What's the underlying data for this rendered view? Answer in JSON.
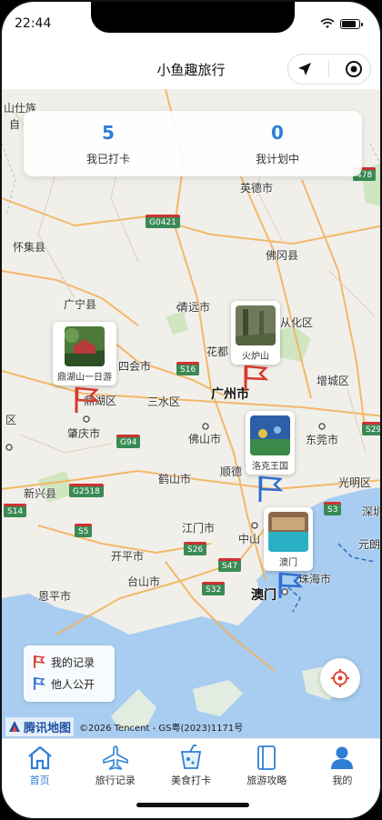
{
  "status": {
    "time": "22:44"
  },
  "nav": {
    "title": "小鱼趣旅行"
  },
  "stats": [
    {
      "value": "5",
      "label": "我已打卡"
    },
    {
      "value": "0",
      "label": "我计划中"
    }
  ],
  "map": {
    "cities": {
      "yingde": "英德市",
      "huaiji": "怀集县",
      "fogang": "佛冈县",
      "guangning": "广宁县",
      "qingyuan": "清远市",
      "huadu": "花都",
      "conghua": "从化区",
      "sihui": "四会市",
      "zengcheng": "增城区",
      "dinghu": "鼎湖区",
      "sanshui": "三水区",
      "guangzhou": "广州市",
      "zhaoqing": "肇庆市",
      "foshan": "佛山市",
      "dongguan": "东莞市",
      "xinxing": "新兴县",
      "heshan": "鹤山市",
      "shunde": "顺德",
      "guangming": "光明区",
      "jiangmen": "江门市",
      "zhongshan": "中山",
      "kaiping": "开平市",
      "taishan": "台山市",
      "enping": "恩平市",
      "zhuhai": "珠海市",
      "macau": "澳门",
      "shenzhen": "深圳",
      "yuanlang": "元朗",
      "shanglin": "山仕族",
      "zi": "自",
      "hui": "区"
    },
    "roads": [
      "G0421",
      "S16",
      "G94",
      "G2518",
      "S5",
      "S26",
      "S47",
      "S32",
      "S3",
      "S29",
      "S14",
      "478"
    ],
    "markers": [
      {
        "name": "鼎湖山一日游"
      },
      {
        "name": "火炉山"
      },
      {
        "name": "洛克王国"
      },
      {
        "name": "澳门"
      }
    ],
    "legend": {
      "mine": "我的记录",
      "public": "他人公开"
    },
    "provider": "腾讯地图",
    "copyright": "©2026 Tencent - GS粤(2023)1171号",
    "colors": {
      "my_flag": "#d63a2e",
      "public_flag": "#2f6fd0"
    }
  },
  "tabs": [
    {
      "label": "首页",
      "icon": "home-icon",
      "active": true
    },
    {
      "label": "旅行记录",
      "icon": "plane-icon",
      "active": false
    },
    {
      "label": "美食打卡",
      "icon": "drink-icon",
      "active": false
    },
    {
      "label": "旅游攻略",
      "icon": "guidebook-icon",
      "active": false
    },
    {
      "label": "我的",
      "icon": "user-icon",
      "active": false
    }
  ]
}
